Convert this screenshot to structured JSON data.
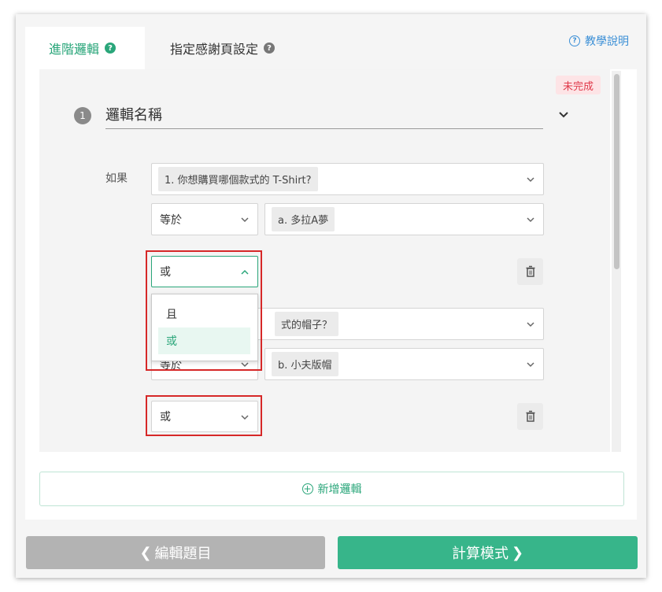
{
  "tabs": {
    "advanced_logic": "進階邏輯",
    "thank_you_page": "指定感謝頁設定"
  },
  "help": {
    "label": "教學說明"
  },
  "status_badge": "未完成",
  "logic": {
    "number": "1",
    "name": "邏輯名稱",
    "if_label": "如果",
    "conditions": [
      {
        "question": "1. 你想購買哪個款式的 T-Shirt?",
        "operator": "等於",
        "answer": "a. 多拉A夢"
      },
      {
        "question_partial": "式的帽子？",
        "operator_partial": "等於",
        "answer": "b. 小夫版帽"
      }
    ],
    "connector_open": "或",
    "connector_second": "或",
    "dropdown_options": [
      "且",
      "或"
    ]
  },
  "buttons": {
    "add_logic": "新增邏輯",
    "back": "編輯題目",
    "next": "計算模式"
  },
  "colors": {
    "accent_green": "#2aa67a",
    "danger_red": "#d62828",
    "help_blue": "#3b8fd6"
  }
}
